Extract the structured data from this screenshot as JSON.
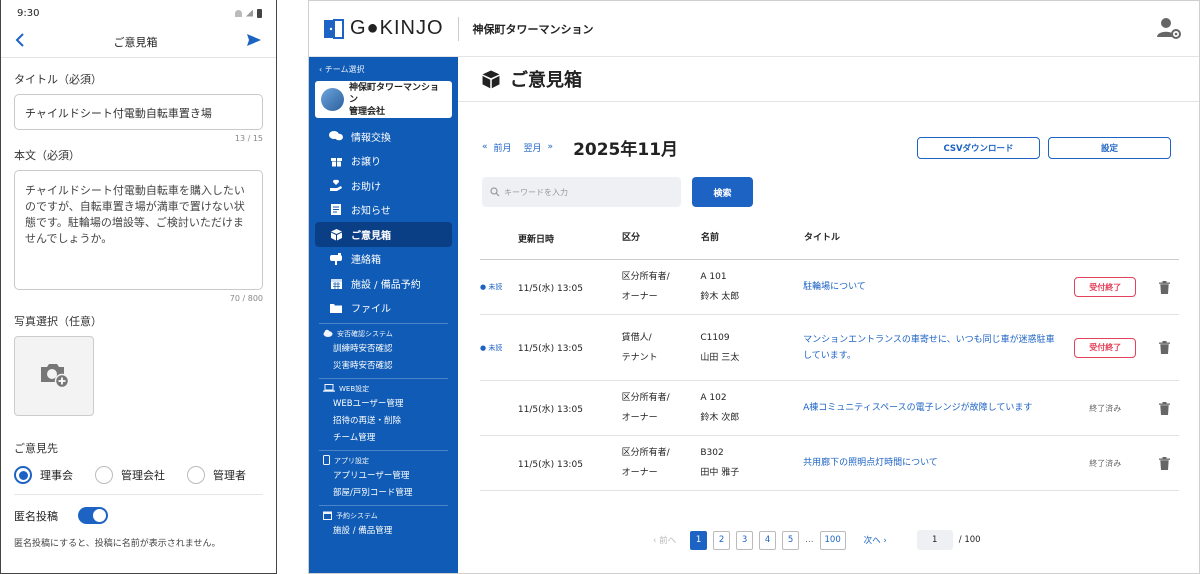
{
  "mobile": {
    "time": "9:30",
    "nav_title": "ご意見箱",
    "title_label": "タイトル（必須）",
    "title_value": "チャイルドシート付電動自転車置き場",
    "title_counter": "13 / 15",
    "body_label": "本文（必須）",
    "body_value": "チャイルドシート付電動自転車を購入したいのですが、自転車置き場が満車で置けない状態です。駐輪場の増設等、ご検討いただけませんでしょうか。",
    "body_counter": "70 / 800",
    "photo_label": "写真選択（任意）",
    "recipient_label": "ご意見先",
    "recipients": [
      "理事会",
      "管理会社",
      "管理者"
    ],
    "selected_recipient": "理事会",
    "anonymous_label": "匿名投稿",
    "anonymous_on": true,
    "anonymous_note": "匿名投稿にすると、投稿に名前が表示されません。"
  },
  "desktop": {
    "logo_text": "G●KINJO",
    "building": "神保町タワーマンション",
    "team_back": "‹ チーム選択",
    "org_name_line1": "神保町タワーマンション",
    "org_name_line2": "管理会社",
    "menu": [
      {
        "label": "情報交換",
        "icon": "chat-icon"
      },
      {
        "label": "お譲り",
        "icon": "gift-icon"
      },
      {
        "label": "お助け",
        "icon": "helping-hand-icon"
      },
      {
        "label": "お知らせ",
        "icon": "notice-icon"
      },
      {
        "label": "ご意見箱",
        "icon": "box-icon",
        "active": true
      },
      {
        "label": "連絡箱",
        "icon": "mailbox-icon"
      },
      {
        "label": "施設 / 備品予約",
        "icon": "calendar-icon"
      },
      {
        "label": "ファイル",
        "icon": "folder-icon"
      }
    ],
    "sections": [
      {
        "head": "安否確認システム",
        "icon": "cloud-icon",
        "items": [
          "訓練時安否確認",
          "災害時安否確認"
        ]
      },
      {
        "head": "WEB設定",
        "icon": "laptop-icon",
        "items": [
          "WEBユーザー管理",
          "招待の再送・削除",
          "チーム管理"
        ]
      },
      {
        "head": "アプリ設定",
        "icon": "phone-icon",
        "items": [
          "アプリユーザー管理",
          "部屋/戸別コード管理"
        ]
      },
      {
        "head": "予約システム",
        "icon": "calendar-small-icon",
        "items": [
          "施設 / 備品管理"
        ]
      }
    ],
    "page_title": "ご意見箱",
    "prev_label": "前月",
    "next_label": "翌月",
    "month": "2025年11月",
    "csv_label": "CSVダウンロード",
    "settings_label": "設定",
    "search_placeholder": "キーワードを入力",
    "search_button": "検索",
    "headers": {
      "date": "更新日時",
      "kind": "区分",
      "name": "名前",
      "title": "タイトル"
    },
    "rows": [
      {
        "badge": "● 未読",
        "date": "11/5(水) 13:05",
        "kind1": "区分所有者/",
        "kind2": "オーナー",
        "room": "A 101",
        "person": "鈴木 太郎",
        "title": "駐輪場について",
        "status": "受付終了",
        "status_type": "red"
      },
      {
        "badge": "● 未読",
        "date": "11/5(水) 13:05",
        "kind1": "賃借人/",
        "kind2": "テナント",
        "room": "C1109",
        "person": "山田 三太",
        "title": "マンションエントランスの車寄せに、いつも同じ車が迷惑駐車しています。",
        "status": "受付終了",
        "status_type": "red"
      },
      {
        "badge": "",
        "date": "11/5(水) 13:05",
        "kind1": "区分所有者/",
        "kind2": "オーナー",
        "room": "A 102",
        "person": "鈴木 次郎",
        "title": "A棟コミュニティスペースの電子レンジが故障しています",
        "status": "終了済み",
        "status_type": "done"
      },
      {
        "badge": "",
        "date": "11/5(水) 13:05",
        "kind1": "区分所有者/",
        "kind2": "オーナー",
        "room": "B302",
        "person": "田中 雅子",
        "title": "共用廊下の照明点灯時間について",
        "status": "終了済み",
        "status_type": "done"
      }
    ],
    "pager": {
      "prev": "前へ",
      "pages": [
        "1",
        "2",
        "3",
        "4",
        "5",
        "…",
        "100"
      ],
      "next": "次へ",
      "current_input": "1",
      "total": "/ 100"
    }
  }
}
